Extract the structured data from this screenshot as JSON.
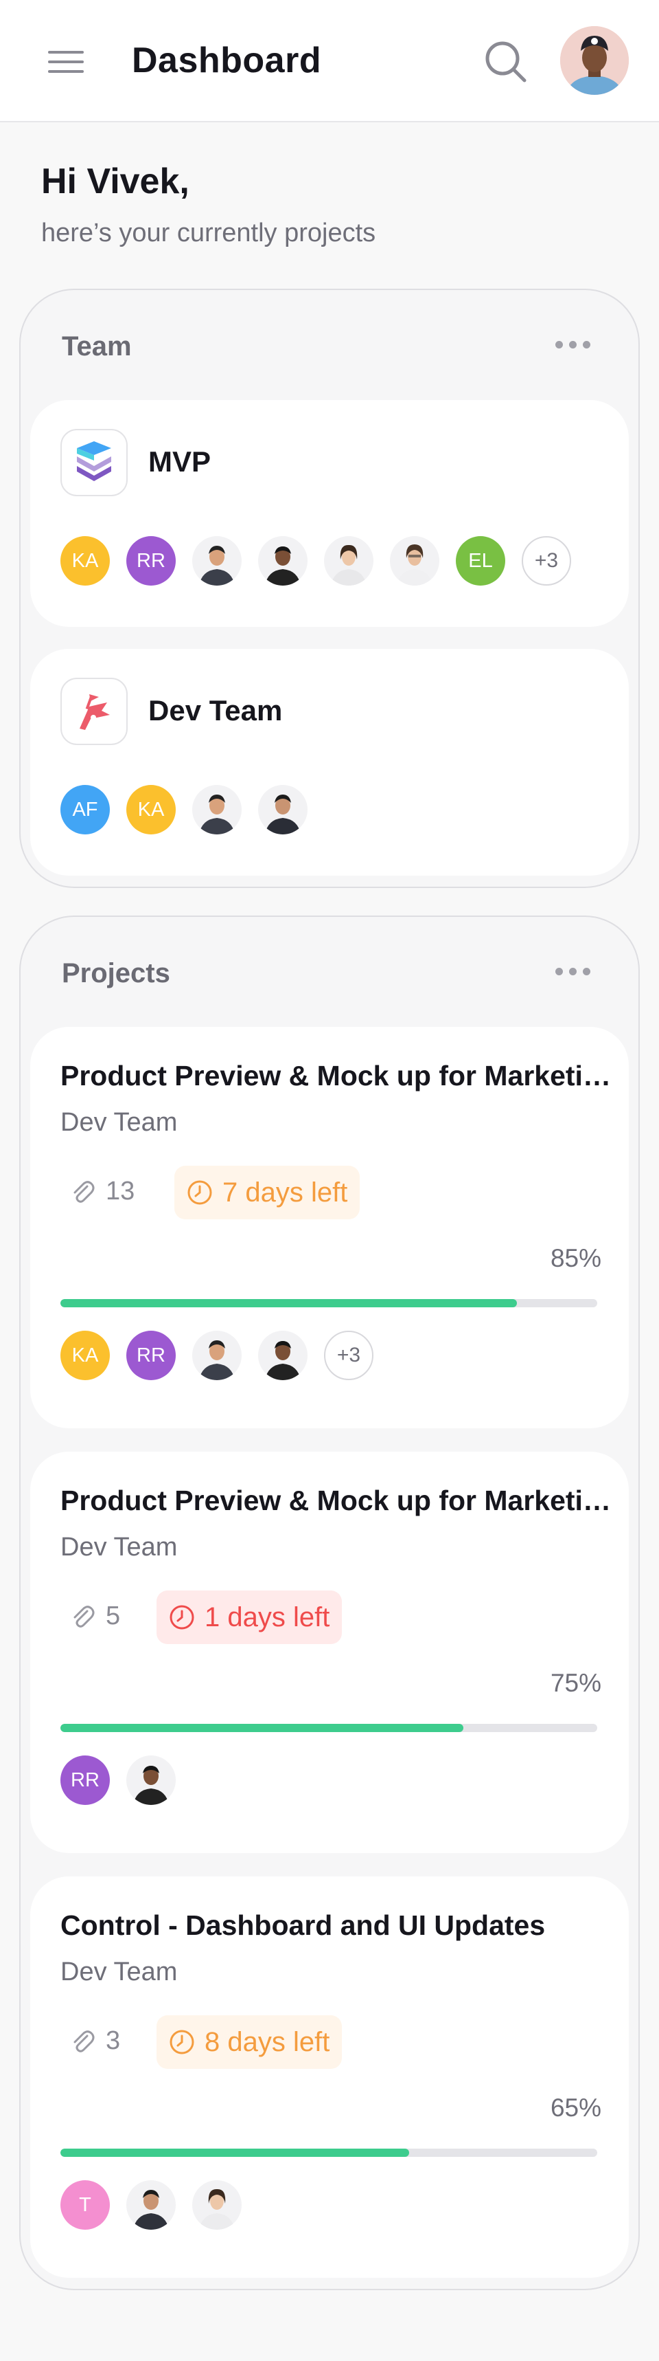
{
  "header": {
    "title": "Dashboard",
    "menu_icon": "hamburger-menu-icon",
    "search_icon": "search-icon"
  },
  "greeting": {
    "title": "Hi Vivek,",
    "subtitle": "here’s your currently projects"
  },
  "teams_section": {
    "title": "Team",
    "teams": [
      {
        "name": "MVP",
        "logo": "layers-logo-icon",
        "members": [
          {
            "initials": "KA",
            "color": "#fbc02d"
          },
          {
            "initials": "RR",
            "color": "#9c59d1"
          },
          {
            "photo": true
          },
          {
            "photo": true
          },
          {
            "photo": true
          },
          {
            "photo": true
          },
          {
            "initials": "EL",
            "color": "#79c043"
          }
        ],
        "more": "+3"
      },
      {
        "name": "Dev Team",
        "logo": "flag-logo-icon",
        "members": [
          {
            "initials": "AF",
            "color": "#42a5f5"
          },
          {
            "initials": "KA",
            "color": "#fbc02d"
          },
          {
            "photo": true
          },
          {
            "photo": true
          }
        ],
        "more": ""
      }
    ]
  },
  "projects_section": {
    "title": "Projects",
    "projects": [
      {
        "title": "Product Preview & Mock up for Marketing",
        "team": "Dev Team",
        "attachments": "13",
        "deadline": "7 days left",
        "deadline_status": "warning",
        "progress_label": "85%",
        "progress": 0.85,
        "members": [
          {
            "initials": "KA",
            "color": "#fbc02d"
          },
          {
            "initials": "RR",
            "color": "#9c59d1"
          },
          {
            "photo": true
          },
          {
            "photo": true
          }
        ],
        "more": "+3"
      },
      {
        "title": "Product Preview & Mock up for Marketing",
        "team": "Dev Team",
        "attachments": "5",
        "deadline": "1 days left",
        "deadline_status": "danger",
        "progress_label": "75%",
        "progress": 0.75,
        "members": [
          {
            "initials": "RR",
            "color": "#9c59d1"
          },
          {
            "photo": true
          }
        ],
        "more": ""
      },
      {
        "title": "Control - Dashboard and UI Updates",
        "team": "Dev Team",
        "attachments": "3",
        "deadline": "8 days left",
        "deadline_status": "warning",
        "progress_label": "65%",
        "progress": 0.65,
        "members": [
          {
            "initials": "T",
            "color": "#f48fd0"
          },
          {
            "photo": true
          },
          {
            "photo": true
          }
        ],
        "more": ""
      }
    ]
  },
  "colors": {
    "progress_fill": "#3dcc8d",
    "warning": "#f49c3e",
    "danger": "#ef4b4b"
  }
}
